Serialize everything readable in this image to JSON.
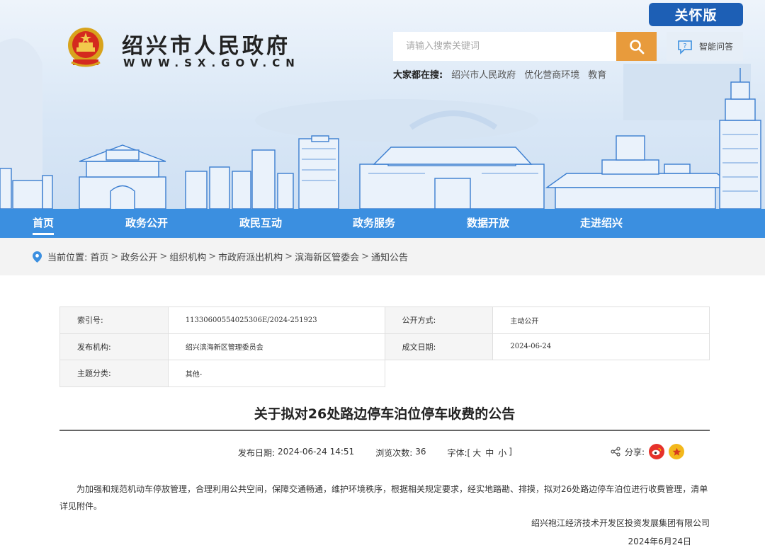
{
  "header": {
    "care_label": "关怀版",
    "site_name": "绍兴市人民政府",
    "site_url": "WWW.SX.GOV.CN",
    "search_placeholder": "请输入搜索关键词",
    "qa_label": "智能问答",
    "hot_label": "大家都在搜:",
    "hot_items": [
      "绍兴市人民政府",
      "优化营商环境",
      "教育"
    ]
  },
  "nav": {
    "items": [
      "首页",
      "政务公开",
      "政民互动",
      "政务服务",
      "数据开放",
      "走进绍兴"
    ]
  },
  "breadcrumb": {
    "label": "当前位置:",
    "items": [
      "首页",
      "政务公开",
      "组织机构",
      "市政府派出机构",
      "滨海新区管委会",
      "通知公告"
    ],
    "separator": ">"
  },
  "info": {
    "index_key": "索引号:",
    "index_val": "11330600554025306E/2024-251923",
    "open_key": "公开方式:",
    "open_val": "主动公开",
    "org_key": "发布机构:",
    "org_val": "绍兴滨海新区管理委员会",
    "date_key": "成文日期:",
    "date_val": "2024-06-24",
    "topic_key": "主题分类:",
    "topic_val": "其他-"
  },
  "article": {
    "title": "关于拟对26处路边停车泊位停车收费的公告",
    "publish_label": "发布日期:",
    "publish_date": "2024-06-24 14:51",
    "views_label": "浏览次数:",
    "views": "36",
    "font_label": "字体:[",
    "font_large": "大",
    "font_mid": "中",
    "font_small": "小",
    "font_end": "]",
    "share_label": "分享:",
    "body": "为加强和规范机动车停放管理，合理利用公共空间，保障交通畅通，维护环境秩序，根据相关规定要求，经实地踏勘、排摸，拟对26处路边停车泊位进行收费管理，清单详见附件。",
    "signature": "绍兴袍江经济技术开发区投资发展集团有限公司",
    "sign_date": "2024年6月24日"
  },
  "colors": {
    "nav_bg": "#3b8fe0",
    "care_bg": "#1d5fb5",
    "search_btn": "#e89b3c",
    "weibo": "#e6322b",
    "star": "#f3b81c"
  }
}
